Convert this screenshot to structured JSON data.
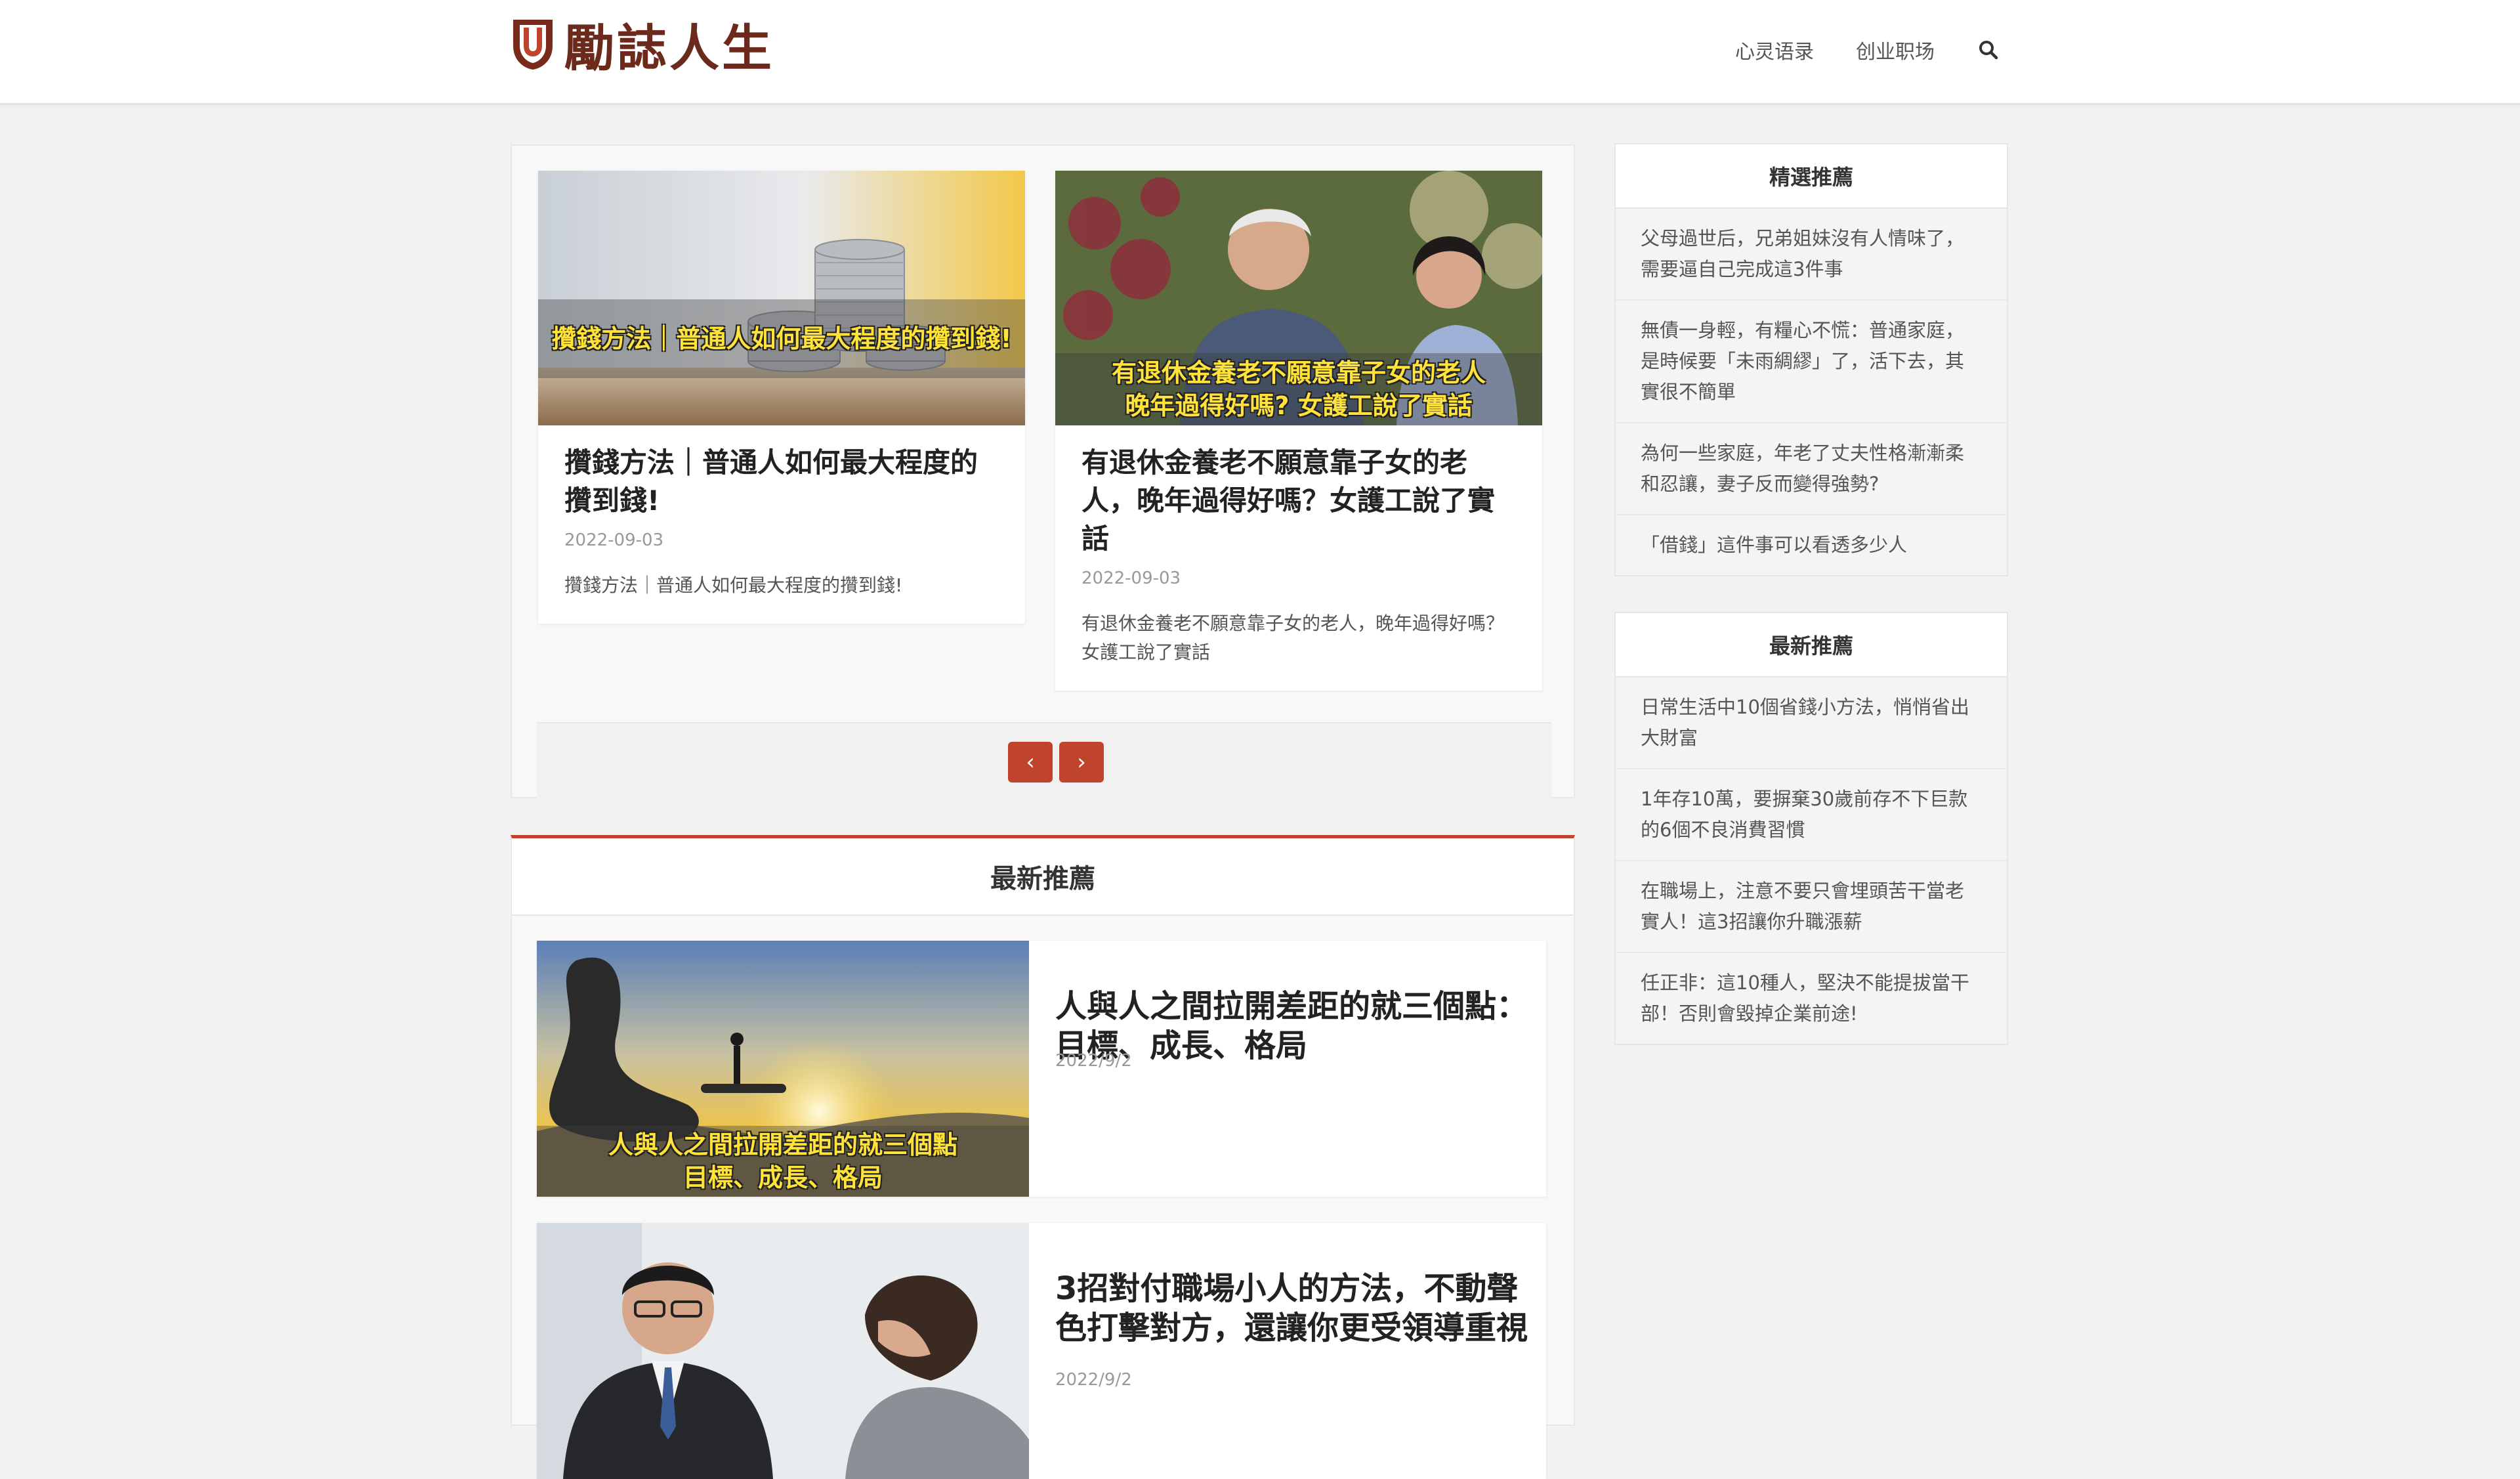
{
  "header": {
    "logo_text": "勵誌人生",
    "nav": [
      "心灵语录",
      "创业职场"
    ]
  },
  "carousel": {
    "slides": [
      {
        "image_caption": "攢錢方法｜普通人如何最大程度的攢到錢!",
        "title": "攢錢方法｜普通人如何最大程度的攢到錢!",
        "date": "2022-09-03",
        "excerpt": "攢錢方法｜普通人如何最大程度的攢到錢!"
      },
      {
        "image_caption_1": "有退休金養老不願意靠子女的老人",
        "image_caption_2": "晚年過得好嗎? 女護工說了實話",
        "title": "有退休金養老不願意靠子女的老人，晚年過得好嗎？女護工說了實話",
        "date": "2022-09-03",
        "excerpt": "有退休金養老不願意靠子女的老人，晚年過得好嗎？女護工說了實話"
      }
    ],
    "prev_label": "‹",
    "next_label": "›"
  },
  "latest": {
    "heading": "最新推薦",
    "posts": [
      {
        "image_caption_1": "人與人之間拉開差距的就三個點",
        "image_caption_2": "目標、成長、格局",
        "title": "人與人之間拉開差距的就三個點：目標、成長、格局",
        "date": "2022/9/2"
      },
      {
        "title": "3招對付職場小人的方法，不動聲色打擊對方，還讓你更受領導重視",
        "date": "2022/9/2"
      }
    ]
  },
  "sidebar": {
    "featured": {
      "title": "精選推薦",
      "items": [
        "父母過世后，兄弟姐妹沒有人情味了，需要逼自己完成這3件事",
        "無債一身輕，有糧心不慌：普通家庭，是時候要「未雨綢繆」了，活下去，其實很不簡單",
        "為何一些家庭，年老了丈夫性格漸漸柔和忍讓，妻子反而變得強勢?",
        "「借錢」這件事可以看透多少人"
      ]
    },
    "latest": {
      "title": "最新推薦",
      "items": [
        "日常生活中10個省錢小方法，悄悄省出大財富",
        "1年存10萬，要摒棄30歲前存不下巨款的6個不良消費習慣",
        "在職場上，注意不要只會埋頭苦干當老實人！這3招讓你升職漲薪",
        "任正非：這10種人，堅決不能提拔當干部！否則會毀掉企業前途!"
      ]
    }
  },
  "colors": {
    "accent": "#c0432e",
    "logo": "#6b2a1c",
    "caption": "#ffe23a"
  },
  "icons": {
    "search": "search-icon",
    "logo_mark": "logo-shield-icon"
  }
}
